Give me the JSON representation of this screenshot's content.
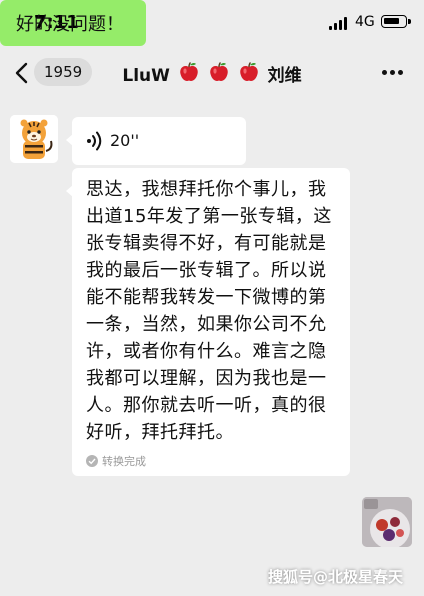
{
  "status_bar": {
    "time": "7:11",
    "network": "4G",
    "icons": [
      "signal-icon",
      "battery-icon"
    ]
  },
  "nav": {
    "unread_count": "1959",
    "title_prefix": "LluW",
    "title_suffix": "刘维",
    "title_emoji_count": 3,
    "icons": [
      "back-icon",
      "apple-icon",
      "more-icon"
    ]
  },
  "messages": {
    "voice": {
      "duration": "20''",
      "icon": "voice-wave-icon"
    },
    "transcript": {
      "text": "思达，我想拜托你个事儿，我出道15年发了第一张专辑，这张专辑卖得不好，有可能就是我的最后一张专辑了。所以说能不能帮我转发一下微博的第一条，当然，如果你公司不允许，或者你有什么。难言之隐我都可以理解，因为我也是一人。那你就去听一听，真的很好听，拜托拜托。",
      "status": "转换完成"
    },
    "sent": {
      "text": "好的没问题！"
    }
  },
  "watermark": "搜狐号@北极星春天",
  "colors": {
    "background": "#ededed",
    "bubble_received": "#ffffff",
    "bubble_sent": "#95ec69",
    "badge": "#dcdcdc"
  }
}
